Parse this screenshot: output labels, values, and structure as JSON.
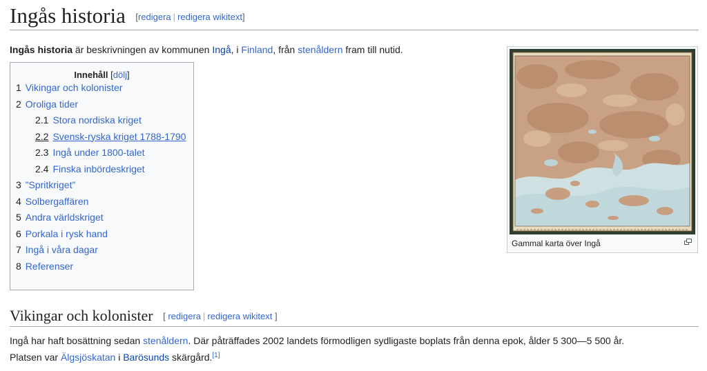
{
  "page": {
    "title": "Ingås historia",
    "edit_label": "redigera",
    "edit_wikitext_label": "redigera wikitext",
    "sep": "|"
  },
  "intro": {
    "bold": "Ingås historia",
    "t1": " är beskrivningen av kommunen ",
    "link1": "Ingå",
    "t2": ", i ",
    "link2": "Finland",
    "t3": ", från ",
    "link3": "stenåldern",
    "t4": " fram till nutid."
  },
  "toc": {
    "title": "Innehåll",
    "toggle_open": "[",
    "toggle_label": "dölj",
    "toggle_close": "]",
    "items": [
      {
        "num": "1",
        "label": "Vikingar och kolonister"
      },
      {
        "num": "2",
        "label": "Oroliga tider"
      },
      {
        "num": "2.1",
        "label": "Stora nordiska kriget"
      },
      {
        "num": "2.2",
        "label": "Svensk-ryska kriget 1788-1790"
      },
      {
        "num": "2.3",
        "label": "Ingå under 1800-talet"
      },
      {
        "num": "2.4",
        "label": "Finska inbördeskriget"
      },
      {
        "num": "3",
        "label": "”Spritkriget”"
      },
      {
        "num": "4",
        "label": "Solbergaffären"
      },
      {
        "num": "5",
        "label": "Andra världskriget"
      },
      {
        "num": "6",
        "label": "Porkala i rysk hand"
      },
      {
        "num": "7",
        "label": "Ingå i våra dagar"
      },
      {
        "num": "8",
        "label": "Referenser"
      }
    ]
  },
  "thumb": {
    "caption": "Gammal karta över Ingå",
    "magnify_icon": "magnify-clip-icon"
  },
  "section1": {
    "heading": "Vikingar och kolonister",
    "bracket_open": "[",
    "bracket_close": "]",
    "p1": "Ingå har haft bosättning sedan ",
    "link1": "stenåldern",
    "p2": ". Där påträffades 2002 landets förmodligen sydligaste boplats från denna epok, ålder 5 300—5 500 år.",
    "p3": "Platsen var ",
    "link2": "Älgsjöskatan",
    "p4": " i ",
    "link3": "Barösunds",
    "p5": " skärgård.",
    "ref": "[1]"
  },
  "colors": {
    "link": "#3366cc",
    "visited_link": "#0645ad",
    "text": "#202122",
    "border": "#a2a9b1",
    "toc_bg": "#f8f9fa"
  }
}
